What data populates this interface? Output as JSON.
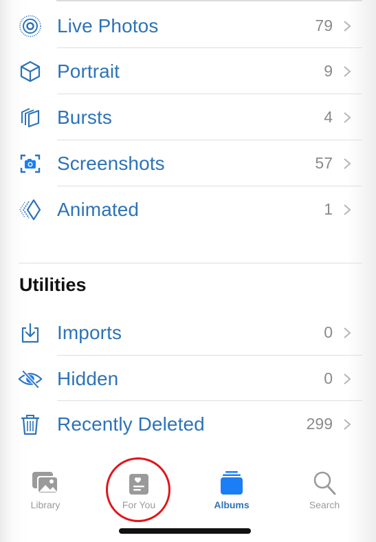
{
  "media_types": [
    {
      "label": "Live Photos",
      "count": "79",
      "icon": "live-photos-icon"
    },
    {
      "label": "Portrait",
      "count": "9",
      "icon": "cube-icon"
    },
    {
      "label": "Bursts",
      "count": "4",
      "icon": "bursts-icon"
    },
    {
      "label": "Screenshots",
      "count": "57",
      "icon": "screenshot-icon"
    },
    {
      "label": "Animated",
      "count": "1",
      "icon": "animated-icon"
    }
  ],
  "utilities": {
    "title": "Utilities",
    "items": [
      {
        "label": "Imports",
        "count": "0",
        "icon": "import-icon"
      },
      {
        "label": "Hidden",
        "count": "0",
        "icon": "eye-slash-icon"
      },
      {
        "label": "Recently Deleted",
        "count": "299",
        "icon": "trash-icon"
      }
    ]
  },
  "tabbar": {
    "tabs": [
      {
        "label": "Library",
        "icon": "photos-stack-icon",
        "active": false
      },
      {
        "label": "For You",
        "icon": "for-you-icon",
        "active": false
      },
      {
        "label": "Albums",
        "icon": "albums-icon",
        "active": true
      },
      {
        "label": "Search",
        "icon": "magnifier-icon",
        "active": false
      }
    ]
  },
  "colors": {
    "accent": "#2d73b8",
    "active_tab_icon": "#1a7ef5",
    "inactive": "#9a9a9a",
    "annotation_circle": "#e0151a"
  }
}
